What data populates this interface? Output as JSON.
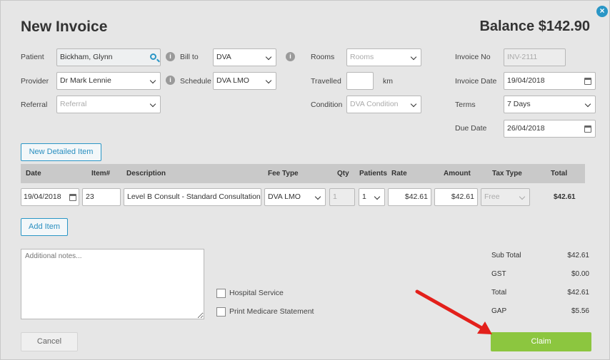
{
  "header": {
    "title": "New Invoice",
    "balance_label": "Balance $142.90"
  },
  "form": {
    "patient_label": "Patient",
    "patient_value": "Bickham, Glynn",
    "provider_label": "Provider",
    "provider_value": "Dr Mark Lennie",
    "referral_label": "Referral",
    "referral_placeholder": "Referral",
    "billto_label": "Bill to",
    "billto_value": "DVA",
    "schedule_label": "Schedule",
    "schedule_value": "DVA LMO",
    "rooms_label": "Rooms",
    "rooms_placeholder": "Rooms",
    "travelled_label": "Travelled",
    "travelled_value": "",
    "travelled_unit": "km",
    "condition_label": "Condition",
    "condition_placeholder": "DVA Condition",
    "invoiceno_label": "Invoice No",
    "invoiceno_value": "INV-2111",
    "invoicedate_label": "Invoice Date",
    "invoicedate_value": "19/04/2018",
    "terms_label": "Terms",
    "terms_value": "7 Days",
    "duedate_label": "Due Date",
    "duedate_value": "26/04/2018"
  },
  "buttons": {
    "new_detailed_item": "New Detailed Item",
    "add_item": "Add Item",
    "cancel": "Cancel",
    "claim": "Claim"
  },
  "table": {
    "columns": [
      "Date",
      "Item#",
      "Description",
      "Fee Type",
      "Qty",
      "Patients",
      "Rate",
      "Amount",
      "Tax Type",
      "Total"
    ],
    "rows": [
      {
        "date": "19/04/2018",
        "item": "23",
        "description": "Level B Consult - Standard Consultation (",
        "fee_type": "DVA LMO",
        "qty": "1",
        "patients": "1",
        "rate": "$42.61",
        "amount": "$42.61",
        "tax_type": "Free",
        "total": "$42.61"
      }
    ]
  },
  "notes": {
    "placeholder": "Additional notes..."
  },
  "options": {
    "hospital_service": "Hospital Service",
    "print_medicare": "Print Medicare Statement"
  },
  "totals": {
    "subtotal_label": "Sub Total",
    "subtotal_value": "$42.61",
    "gst_label": "GST",
    "gst_value": "$0.00",
    "total_label": "Total",
    "total_value": "$42.61",
    "gap_label": "GAP",
    "gap_value": "$5.56"
  },
  "icons": {
    "close": "close-icon",
    "info": "info-icon",
    "search": "search-icon",
    "calendar": "calendar-icon",
    "chevron": "chevron-down-icon"
  },
  "colors": {
    "accent": "#2a96c6",
    "claim_green": "#8cc63f",
    "arrow_red": "#e3201b"
  }
}
